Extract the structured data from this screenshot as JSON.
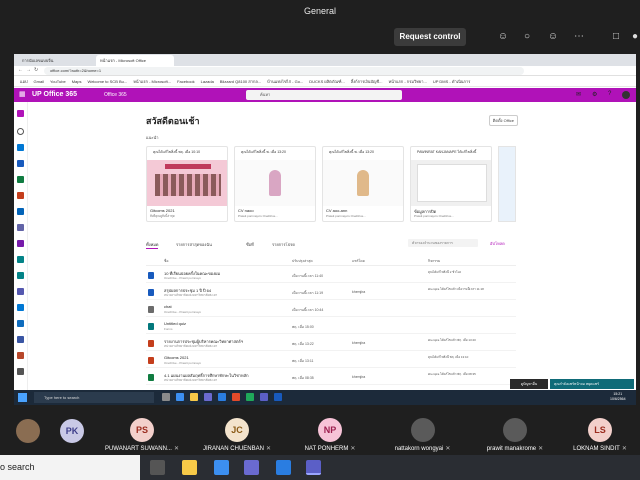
{
  "teams": {
    "title": "General",
    "request_control": "Request control"
  },
  "browser": {
    "tabs": [
      "การนับเลขแบบจีน",
      "หน้าแรก - Microsoft Office"
    ],
    "address": "office.com/?auth=2&home=1",
    "bookmarks": [
      "แอป",
      "Gmail",
      "YouTube",
      "Maps",
      "Welcome to SCB Bu...",
      "หน้าแรก - Microsoft...",
      "Facebook",
      "Lazada",
      "Blizzard Q8100 สากล...",
      "บ้านแห่งไข่ไก่ - Go...",
      "DUCKS ผลิตภัณฑ์...",
      "ลิ้งก์การเงินบัญชี...",
      "หน้าแรก - กรมวิทยา...",
      "UP DMS - ดำเนินการ"
    ]
  },
  "office": {
    "brand": "UP Office 365",
    "app": "Office 365",
    "search_placeholder": "ค้นหา",
    "greeting": "สวัสดีตอนเช้า",
    "install": "ติดตั้ง Office",
    "recent_label": "แนะนำ",
    "cards": [
      {
        "head": "คุณได้แก้ไขสิ่งนี้ พฤ. เมื่อ 10:10",
        "title": "Gitcoms 2021",
        "sub": "สิ่งที่คุณดูสิ่งนี้ล่าสุด"
      },
      {
        "head": "คุณได้แก้ไขสิ่งนี้ พ. เมื่อ 13:20",
        "title": "CV naoo",
        "sub": "Prawit pornnayo's OneDrive..."
      },
      {
        "head": "คุณได้แก้ไขสิ่งนี้ พ. เมื่อ 13:20",
        "title": "CV aoo-ann",
        "sub": "Prawit pornnayo's OneDrive..."
      },
      {
        "head": "PAWINRAT KANJANAPE ได้แก้ไขสิ่งนี้",
        "title": "ข้อมูลการปิด",
        "sub": "Prawit pornnayo's OneDrive..."
      }
    ],
    "filter_tabs": [
      "ทั้งหมด",
      "รายการล่าสุดของฉัน",
      "ชื่อที่",
      "รายการโปรด"
    ],
    "filter_placeholder": "ตัวกรองจำนวนของรายการ",
    "upload": "อัปโหลด",
    "columns": [
      "ชื่อ",
      "ปรับปรุงล่าสุด",
      "แชร์โดย",
      "กิจกรรม"
    ],
    "files": [
      {
        "name": "10 ที่เรียนบ่อยครั้งในคณะของผม",
        "loc": "OneDrive - Prawit pornnayo",
        "date": "เมื่อวานนี้เวลา 11:40",
        "share": "",
        "act": "คุณได้แก้ไขสิ่งนี้ 2 ชั่วโมง",
        "color": "#185abd"
      },
      {
        "name": "สรุปผลการประชุม 1 ปี ปี 64",
        "loc": "หน่วยงานวิทยาลัยแห่งมหาวิทยาลัยพะเยา",
        "date": "เมื่อวานนี้เวลา 11:19",
        "share": "khemjira",
        "act": "khemjira ได้แก้ไขแล้ว เมื่อวานนี้เวลา 11:18",
        "color": "#185abd"
      },
      {
        "name": "chat",
        "loc": "OneDrive - Prawit pornnayo",
        "date": "เมื่อวานนี้เวลา 10:44",
        "share": "",
        "act": "",
        "color": "#6b6b6b"
      },
      {
        "name": "Untitled quiz",
        "loc": "Forms",
        "date": "พฤ. เมื่อ 15:00",
        "share": "",
        "act": "",
        "color": "#03787c"
      },
      {
        "name": "รายงานการประชุมผู้บริหารคณะวิทยาศาสตร์ฯ",
        "loc": "หน่วยงานวิทยาลัยแห่งมหาวิทยาลัยพะเยา",
        "date": "พฤ. เมื่อ 13:22",
        "share": "khemjira",
        "act": "khemjira ได้แก้ไขแล้ว พฤ. เมื่อ 13:20",
        "color": "#c43e1c"
      },
      {
        "name": "Gitcoms 2021",
        "loc": "OneDrive - Prawit pornnayo",
        "date": "พฤ. เมื่อ 13:11",
        "share": "",
        "act": "คุณได้แก้ไขสิ่งนี้ พฤ. เมื่อ 13:10",
        "color": "#c43e1c"
      },
      {
        "name": "4.1 แผนงานผลสัมฤทธิ์การศึกษาทักษะในวิชาหลัก",
        "loc": "หน่วยงานวิทยาลัยแห่งมหาวิทยาลัยพะเยา",
        "date": "พฤ. เมื่อ 08:35",
        "share": "khemjira",
        "act": "khemjira ได้แก้ไขแล้ว พฤ. เมื่อ 08:35",
        "color": "#107c41"
      }
    ],
    "taskbar_search": "Type here to search",
    "clock_time": "15:21",
    "clock_date": "10/6/2564",
    "toast1": "ดูปัญหาอื่น",
    "toast2": "คุณกำลังแชร์หน้าจอ หยุดแชร์"
  },
  "participants": [
    {
      "initials": "PS",
      "name": "PUWANART SUWANN...",
      "bg": "#f3d0cb",
      "fg": "#9b2c1f"
    },
    {
      "initials": "JC",
      "name": "JIRANAN CHUENBAN",
      "bg": "#f3e3cc",
      "fg": "#8a5a16"
    },
    {
      "initials": "NP",
      "name": "NAT PONHERM",
      "bg": "#f7c3d7",
      "fg": "#9c1e4e"
    },
    {
      "initials": "",
      "name": "nattakorn wongyai",
      "bg": "#5a5a5a",
      "fg": "#fff"
    },
    {
      "initials": "",
      "name": "prawit manakrome",
      "bg": "#5a5a5a",
      "fg": "#fff"
    },
    {
      "initials": "LS",
      "name": "LOKNAM SINDIT",
      "bg": "#f3d0cb",
      "fg": "#9b2c1f"
    }
  ],
  "extra_avatar": "PK",
  "host": {
    "search": "o search"
  }
}
